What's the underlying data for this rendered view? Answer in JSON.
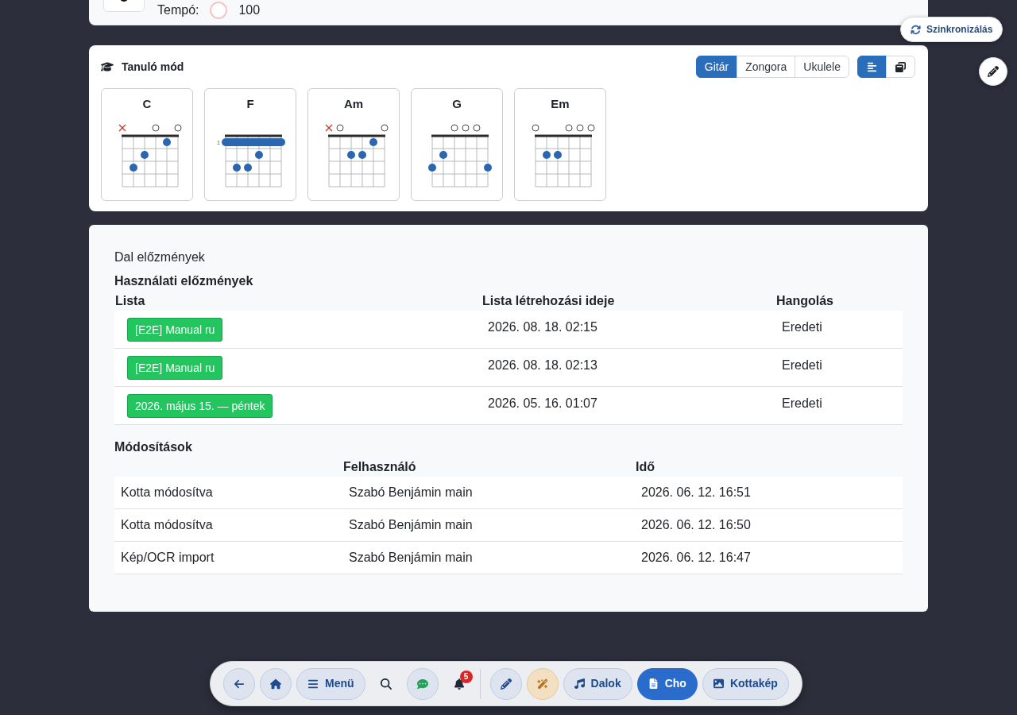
{
  "tempo_card": {
    "label": "Tempó:",
    "value": "100"
  },
  "sync_button": {
    "label": "Szinkronizálás"
  },
  "learning": {
    "title": "Tanuló mód",
    "instruments": [
      {
        "label": "Gitár",
        "selected": true
      },
      {
        "label": "Zongora",
        "selected": false
      },
      {
        "label": "Ukulele",
        "selected": false
      }
    ],
    "views": [
      {
        "kind": "list",
        "selected": true
      },
      {
        "kind": "cards",
        "selected": false
      }
    ],
    "chords": [
      {
        "name": "C",
        "barre": false,
        "strings": [
          {
            "kind": "muted"
          },
          {
            "kind": "fret3"
          },
          {
            "kind": "fret2"
          },
          {
            "kind": "open"
          },
          {
            "kind": "fret1"
          },
          {
            "kind": "open"
          }
        ]
      },
      {
        "name": "F",
        "barre": true,
        "fret_label": "1",
        "strings": [
          {
            "kind": "fret1"
          },
          {
            "kind": "fret3"
          },
          {
            "kind": "fret3"
          },
          {
            "kind": "fret2"
          },
          {
            "kind": "fret1"
          },
          {
            "kind": "fret1"
          }
        ]
      },
      {
        "name": "Am",
        "barre": false,
        "strings": [
          {
            "kind": "muted"
          },
          {
            "kind": "open"
          },
          {
            "kind": "fret2"
          },
          {
            "kind": "fret2"
          },
          {
            "kind": "fret1"
          },
          {
            "kind": "open"
          }
        ]
      },
      {
        "name": "G",
        "barre": false,
        "strings": [
          {
            "kind": "fret3"
          },
          {
            "kind": "fret2"
          },
          {
            "kind": "open"
          },
          {
            "kind": "open"
          },
          {
            "kind": "open"
          },
          {
            "kind": "fret3"
          }
        ]
      },
      {
        "name": "Em",
        "barre": false,
        "strings": [
          {
            "kind": "open"
          },
          {
            "kind": "fret2"
          },
          {
            "kind": "fret2"
          },
          {
            "kind": "open"
          },
          {
            "kind": "open"
          },
          {
            "kind": "open"
          }
        ]
      }
    ]
  },
  "history": {
    "title": "Dal előzmények",
    "usage": {
      "title": "Használati előzmények",
      "columns": [
        "Lista",
        "Lista létrehozási ideje",
        "Hangolás"
      ],
      "rows": [
        {
          "list": "[E2E] Manual ru",
          "created": "2026. 08. 18. 02:15",
          "tuning": "Eredeti"
        },
        {
          "list": "[E2E] Manual ru",
          "created": "2026. 08. 18. 02:13",
          "tuning": "Eredeti"
        },
        {
          "list": "2026. május 15. — péntek",
          "created": "2026. 05. 16. 01:07",
          "tuning": "Eredeti"
        }
      ]
    },
    "changes": {
      "title": "Módosítások",
      "user_header": "Felhasználó",
      "time_header": "Idő",
      "rows": [
        {
          "action": "Kotta módosítva",
          "user": "Szabó Benjámin main",
          "time": "2026. 06. 12. 16:51"
        },
        {
          "action": "Kotta módosítva",
          "user": "Szabó Benjámin main",
          "time": "2026. 06. 12. 16:50"
        },
        {
          "action": "Kép/OCR import",
          "user": "Szabó Benjámin main",
          "time": "2026. 06. 12. 16:47"
        }
      ]
    }
  },
  "toolbar": {
    "actions": [
      {
        "kind": "back"
      },
      {
        "kind": "home"
      },
      {
        "kind": "menu",
        "label": "Menü"
      },
      {
        "kind": "search"
      },
      {
        "kind": "chat"
      },
      {
        "kind": "notifications",
        "badge": "5"
      }
    ],
    "tools": [
      {
        "kind": "edit"
      },
      {
        "kind": "magic"
      }
    ],
    "views": [
      {
        "kind": "songs",
        "label": "Dalok",
        "selected": false
      },
      {
        "kind": "chords",
        "label": "Cho",
        "selected": true
      },
      {
        "kind": "sheet",
        "label": "Kottakép",
        "selected": false
      }
    ]
  }
}
